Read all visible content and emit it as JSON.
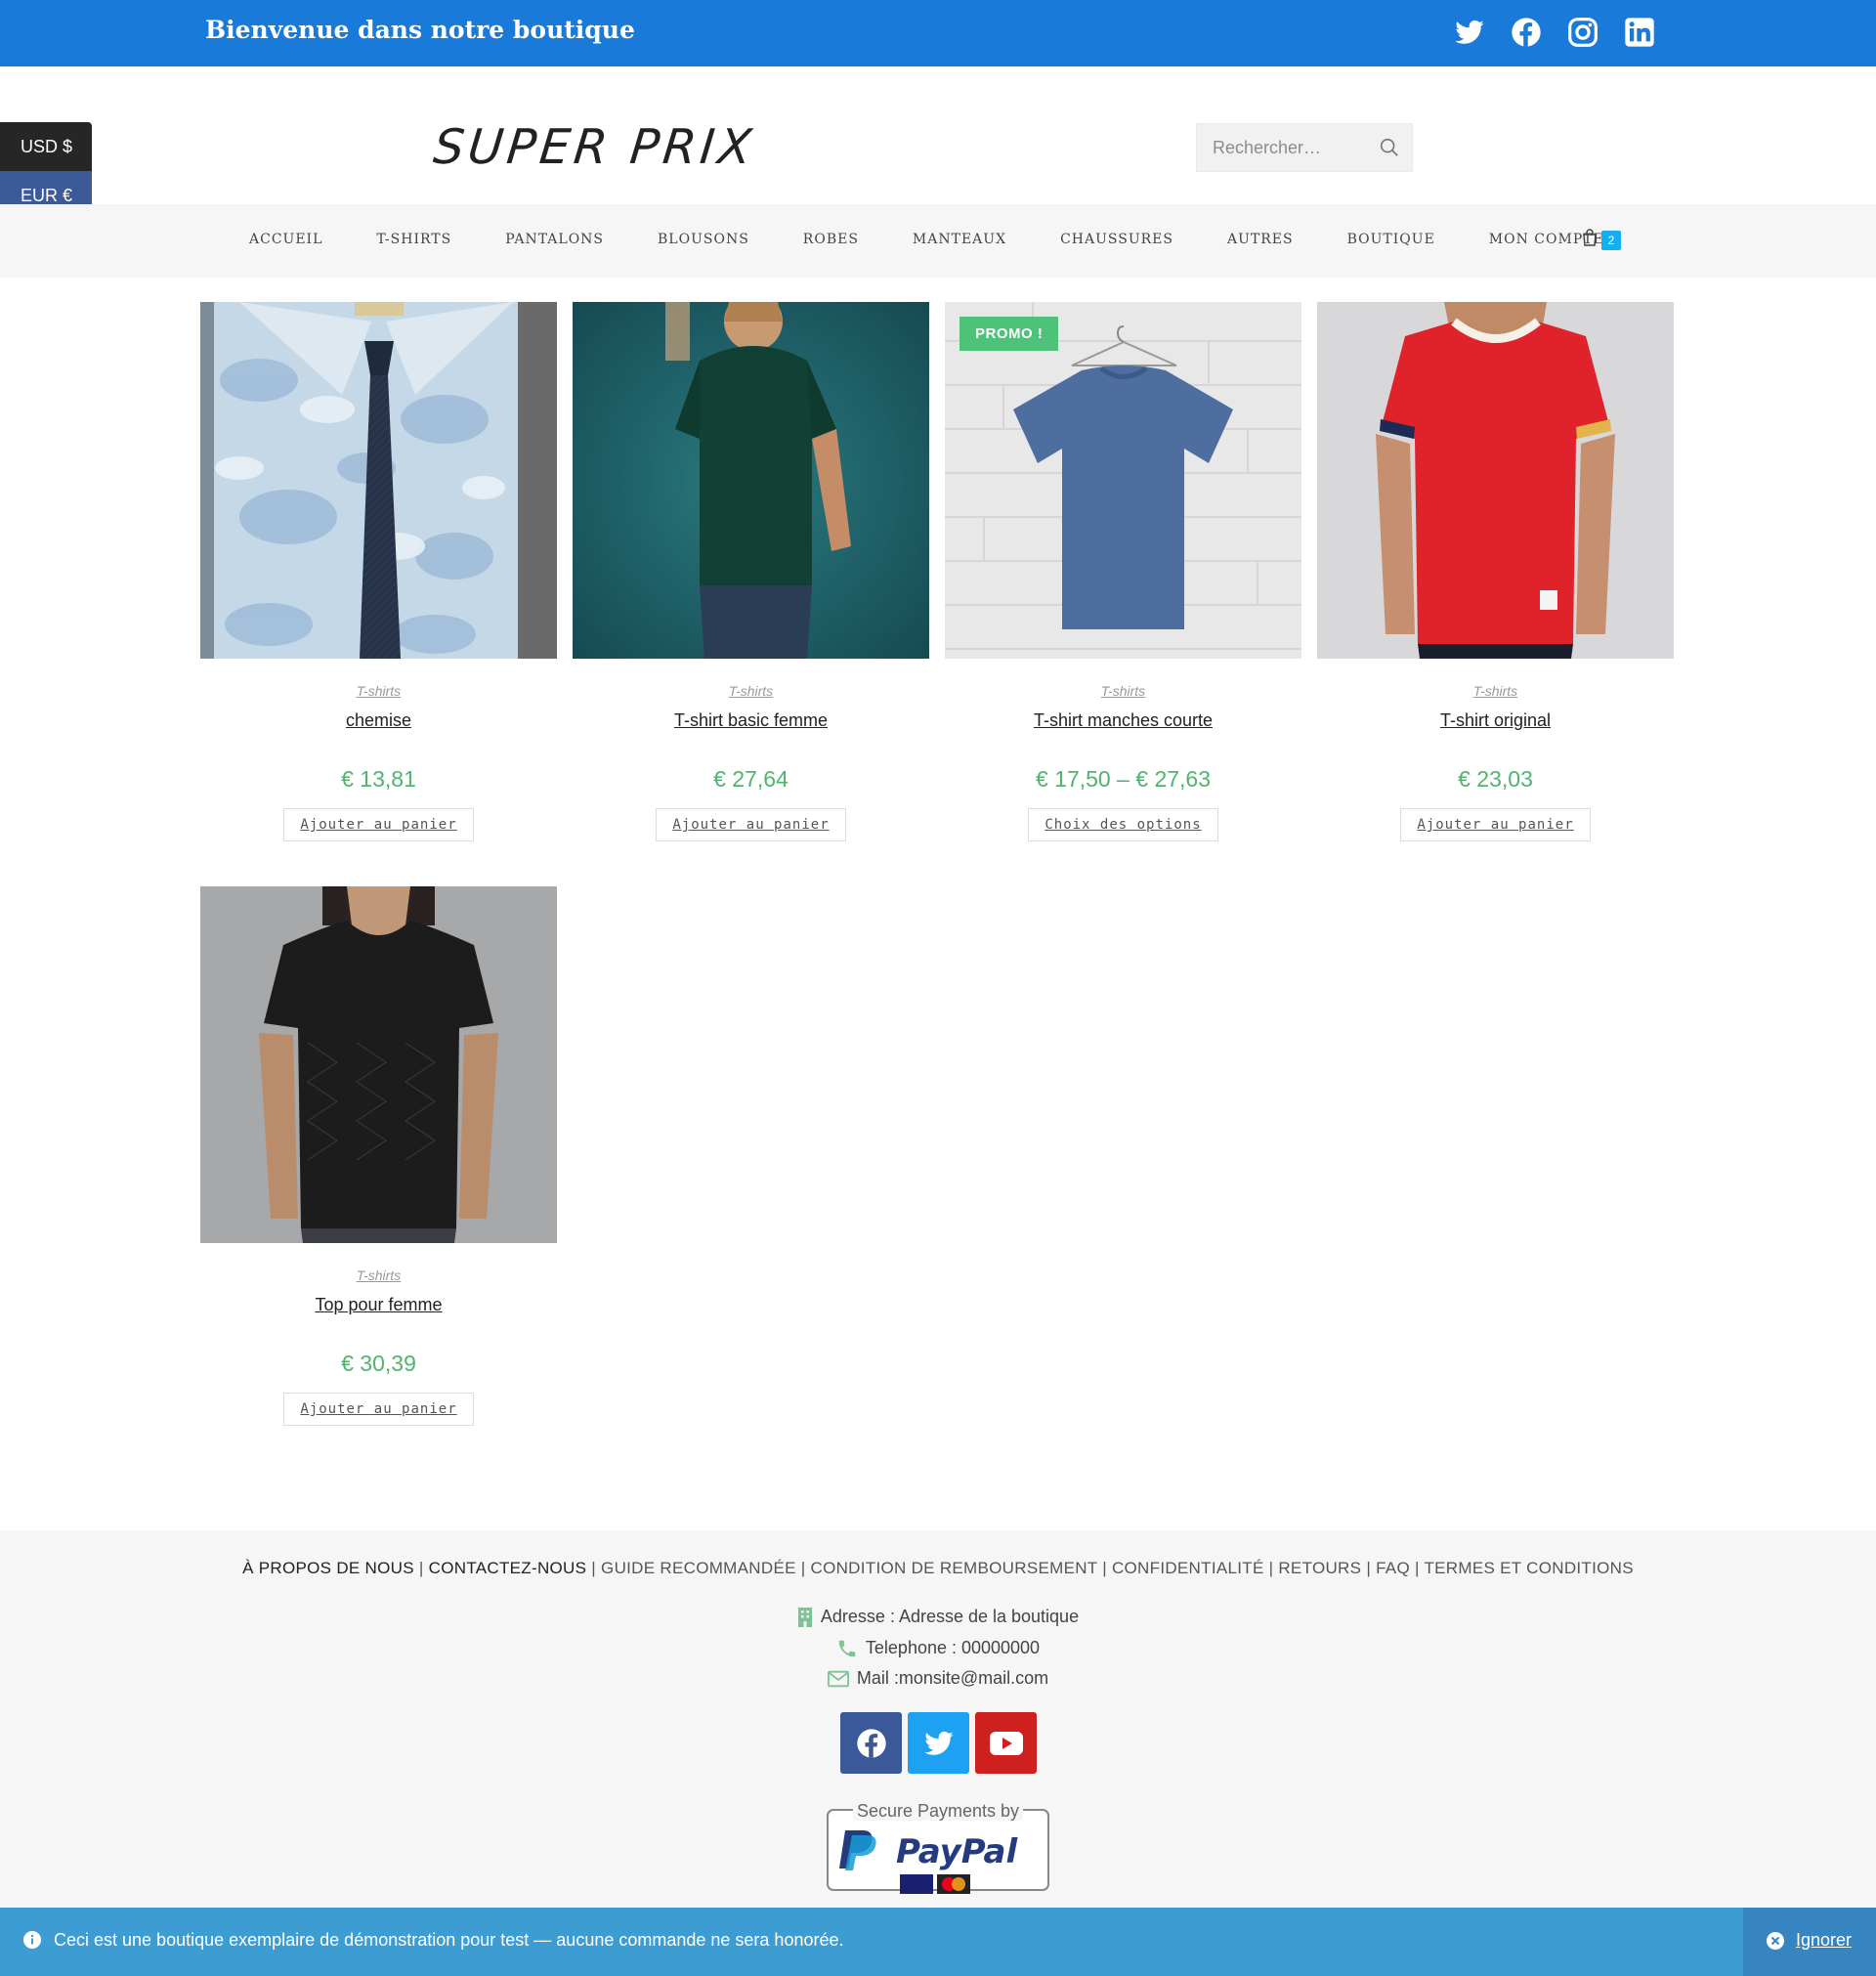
{
  "topbar": {
    "welcome": "Bienvenue dans notre boutique",
    "socials": [
      "twitter-icon",
      "facebook-icon",
      "instagram-icon",
      "linkedin-icon"
    ]
  },
  "currency": {
    "usd": "USD $",
    "eur": "EUR €"
  },
  "header": {
    "logo": "SUPER PRIX",
    "search_placeholder": "Rechercher…"
  },
  "nav": {
    "items": [
      "ACCUEIL",
      "T-SHIRTS",
      "PANTALONS",
      "BLOUSONS",
      "ROBES",
      "MANTEAUX",
      "CHAUSSURES",
      "AUTRES",
      "BOUTIQUE",
      "MON COMPTE"
    ],
    "cart_count": "2"
  },
  "products": [
    {
      "category": "T-shirts",
      "name": "chemise",
      "price": "€ 13,81",
      "button": "Ajouter au panier"
    },
    {
      "category": "T-shirts",
      "name": "T-shirt basic femme",
      "price": "€ 27,64",
      "button": "Ajouter au panier"
    },
    {
      "category": "T-shirts",
      "name": "T-shirt manches courte",
      "price": "€ 17,50 – € 27,63",
      "button": "Choix des options",
      "badge": "PROMO !"
    },
    {
      "category": "T-shirts",
      "name": "T-shirt original",
      "price": "€ 23,03",
      "button": "Ajouter au panier"
    },
    {
      "category": "T-shirts",
      "name": "Top pour femme",
      "price": "€ 30,39",
      "button": "Ajouter au panier"
    }
  ],
  "footer": {
    "links": [
      "À PROPOS DE NOUS",
      "CONTACTEZ-NOUS",
      "GUIDE RECOMMANDÉE",
      "CONDITION DE REMBOURSEMENT",
      "CONFIDENTIALITÉ",
      "RETOURS",
      "FAQ",
      "TERMES ET CONDITIONS"
    ],
    "address": "Adresse : Adresse de la boutique",
    "phone": "Telephone : 00000000",
    "mail": "Mail :monsite@mail.com",
    "paypal_text": "Secure Payments by",
    "paypal_brand": "PayPal"
  },
  "notice": {
    "message": "Ceci est une boutique exemplaire de démonstration pour test — aucune commande ne sera honorée.",
    "dismiss": "Ignorer"
  },
  "colors": {
    "topbar": "#1a7ad9",
    "price": "#4fb46e",
    "promo": "#4fc27a",
    "notice": "#3d9cd2",
    "cart_badge": "#13aff0"
  }
}
